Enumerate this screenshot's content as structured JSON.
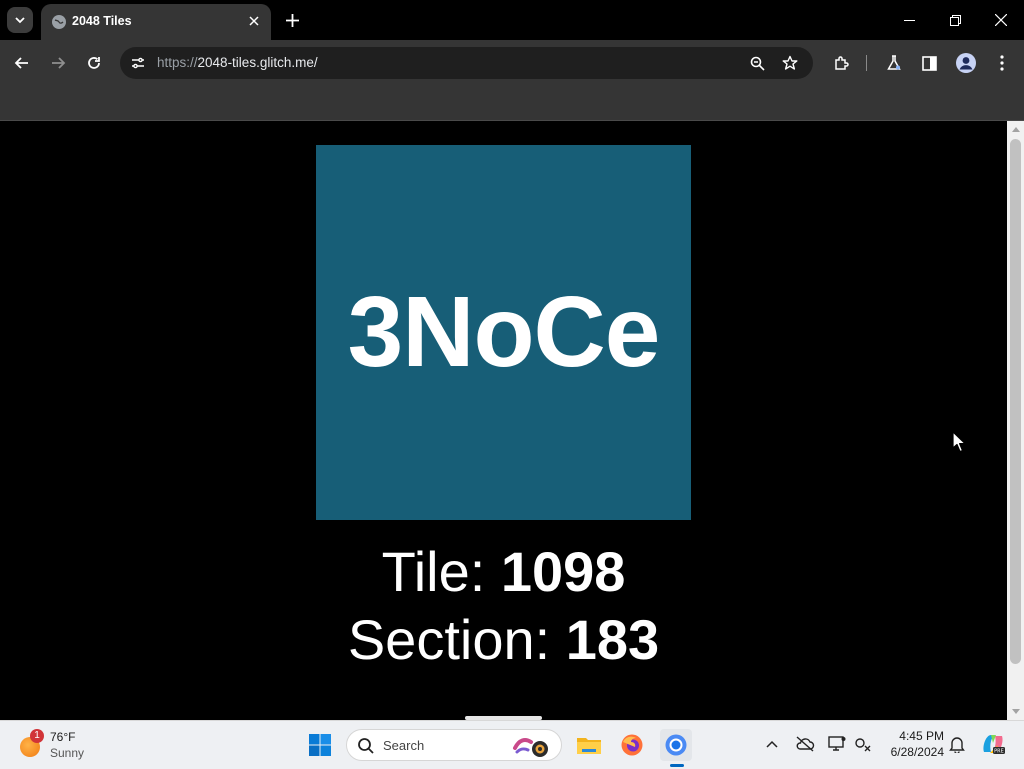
{
  "browser": {
    "tab": {
      "title": "2048 Tiles"
    },
    "url": {
      "scheme": "https://",
      "host": "2048-tiles.glitch.me/"
    }
  },
  "page": {
    "tile_text": "3NoCe",
    "tile_color": "#175e77",
    "tile_label": "Tile: ",
    "tile_value": "1098",
    "section_label": "Section: ",
    "section_value": "183"
  },
  "taskbar": {
    "weather": {
      "temp": "76°F",
      "condition": "Sunny",
      "badge": "1"
    },
    "search_label": "Search",
    "clock": {
      "time": "4:45 PM",
      "date": "6/28/2024"
    }
  },
  "icons": [
    "tab-search-icon",
    "globe-icon",
    "close-icon",
    "plus-icon",
    "minimize-icon",
    "restore-icon",
    "back-icon",
    "forward-icon",
    "reload-icon",
    "site-info-icon",
    "zoom-icon",
    "star-icon",
    "extensions-icon",
    "labs-icon",
    "side-panel-icon",
    "profile-icon",
    "menu-icon",
    "windows-start-icon",
    "search-icon",
    "file-explorer-icon",
    "firefox-icon",
    "chrome-icon",
    "chevron-up-icon",
    "cloud-off-icon",
    "display-icon",
    "network-icon",
    "bell-icon",
    "copilot-icon"
  ]
}
